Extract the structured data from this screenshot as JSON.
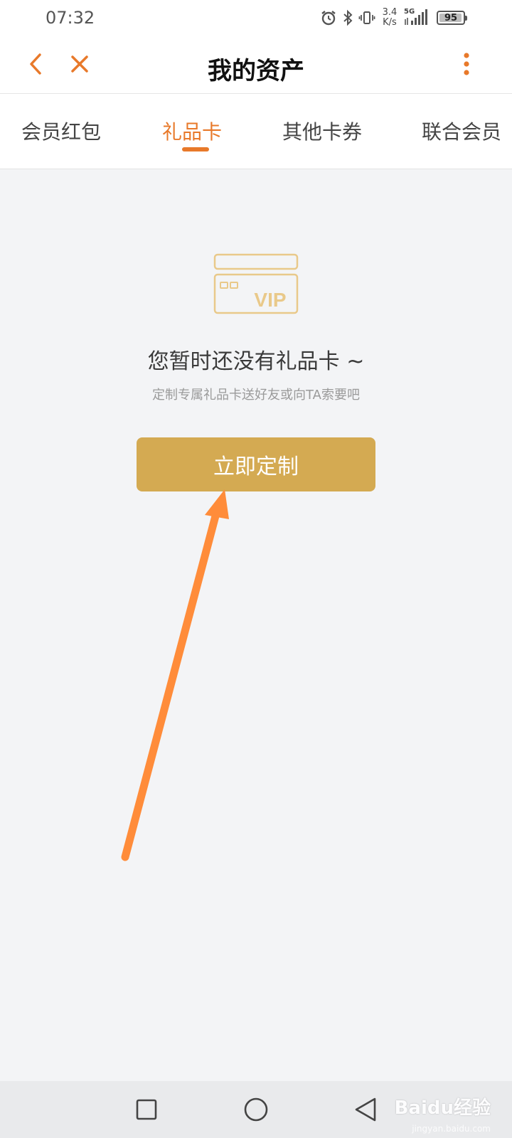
{
  "status_bar": {
    "time": "07:32",
    "net_speed_value": "3.4",
    "net_speed_unit": "K/s",
    "network_type": "5G",
    "battery_level": "95",
    "icons": [
      "alarm-icon",
      "bluetooth-icon",
      "vibrate-icon",
      "signal-icon",
      "battery-icon"
    ]
  },
  "nav": {
    "title": "我的资产",
    "back_icon": "chevron-left-icon",
    "close_icon": "close-icon",
    "more_icon": "more-vertical-icon"
  },
  "tabs": [
    {
      "label": "会员红包",
      "active": false
    },
    {
      "label": "礼品卡",
      "active": true
    },
    {
      "label": "其他卡券",
      "active": false
    },
    {
      "label": "联合会员",
      "active": false
    }
  ],
  "empty_state": {
    "icon": "vip-card-icon",
    "icon_text": "VIP",
    "title": "您暂时还没有礼品卡 ~",
    "subtitle": "定制专属礼品卡送好友或向TA索要吧",
    "button_label": "立即定制"
  },
  "system_nav": {
    "icons": [
      "recents-square-icon",
      "home-circle-icon",
      "back-triangle-icon"
    ]
  },
  "watermark": {
    "text": "Baidu经验",
    "sub": "jingyan.baidu.com"
  },
  "colors": {
    "accent": "#e8792a",
    "button": "#d4aa52",
    "icon_gold": "#e9c98a",
    "arrow": "#ff8c3a",
    "background": "#f3f4f6"
  }
}
